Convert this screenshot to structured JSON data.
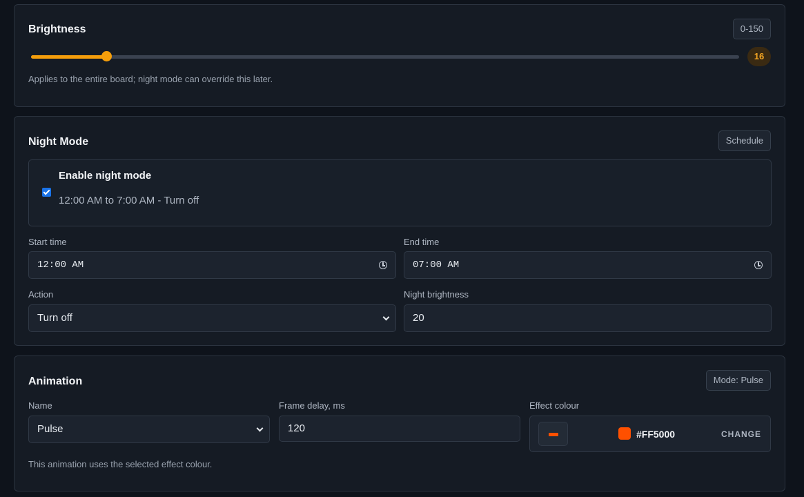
{
  "brightness": {
    "title": "Brightness",
    "range_chip": "0-150",
    "value": 16,
    "value_label": "16",
    "min": 0,
    "max": 150,
    "help": "Applies to the entire board; night mode can override this later.",
    "accent": "#f59e0b"
  },
  "night_mode": {
    "title": "Night Mode",
    "chip": "Schedule",
    "enable_label": "Enable night mode",
    "enabled": true,
    "summary": "12:00 AM to 7:00 AM - Turn off",
    "start_label": "Start time",
    "start_value": "12:00 AM",
    "end_label": "End time",
    "end_value": "07:00 AM",
    "action_label": "Action",
    "action_value": "Turn off",
    "night_brightness_label": "Night brightness",
    "night_brightness_value": "20"
  },
  "animation": {
    "title": "Animation",
    "chip": "Mode: Pulse",
    "name_label": "Name",
    "name_value": "Pulse",
    "frame_delay_label": "Frame delay, ms",
    "frame_delay_value": "120",
    "effect_colour_label": "Effect colour",
    "effect_colour_hex": "#FF5000",
    "change_label": "CHANGE",
    "help": "This animation uses the selected effect colour.",
    "effect_colour": "#ff5000"
  },
  "icons": {
    "time": "clock-icon",
    "select": "chevron-down-icon"
  }
}
